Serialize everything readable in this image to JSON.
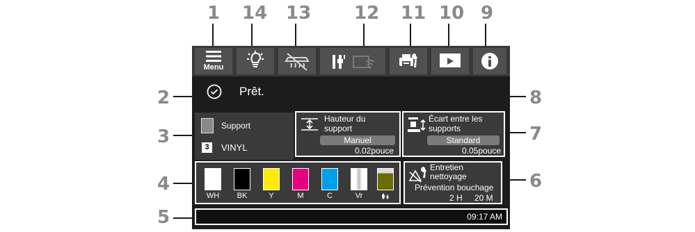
{
  "callouts": [
    "1",
    "14",
    "13",
    "12",
    "11",
    "10",
    "9",
    "2",
    "8",
    "3",
    "7",
    "4",
    "6",
    "5"
  ],
  "toolbar": {
    "menu_label": "Menu",
    "buttons": [
      {
        "name": "menu-button",
        "icon": "hamburger-icon"
      },
      {
        "name": "light-button",
        "icon": "lightbulb-icon"
      },
      {
        "name": "heater-off-button",
        "icon": "heater-off-icon"
      },
      {
        "name": "network-status-button",
        "icon": "wired-wifi-icon"
      },
      {
        "name": "maintenance-button",
        "icon": "printer-wrench-icon"
      },
      {
        "name": "video-button",
        "icon": "play-video-icon"
      },
      {
        "name": "info-button",
        "icon": "info-icon"
      }
    ]
  },
  "status": {
    "text": "Prêt.",
    "icon": "check-circle-icon"
  },
  "media": {
    "label": "Support",
    "slot": "3",
    "name": "VINYL"
  },
  "platen_gap": {
    "title_line1": "Hauteur du",
    "title_line2": "support",
    "mode": "Manuel",
    "value": "0.02pouce"
  },
  "media_gap": {
    "title_line1": "Écart entre les",
    "title_line2": "supports",
    "mode": "Standard",
    "value": "0.05pouce"
  },
  "inks": [
    {
      "label": "WH",
      "color": "#ffffff"
    },
    {
      "label": "BK",
      "color": "#000000"
    },
    {
      "label": "Y",
      "color": "#ffeb00"
    },
    {
      "label": "M",
      "color": "#e5007e"
    },
    {
      "label": "C",
      "color": "#00a0e9"
    },
    {
      "label": "Vr",
      "color": "#ffffff"
    }
  ],
  "maintenance": {
    "title_line1": "Entretien",
    "title_line2": "nettoyage",
    "subtitle": "Prévention bouchage",
    "hours": "2 H",
    "minutes": "20 M"
  },
  "clock": "09:17 AM"
}
